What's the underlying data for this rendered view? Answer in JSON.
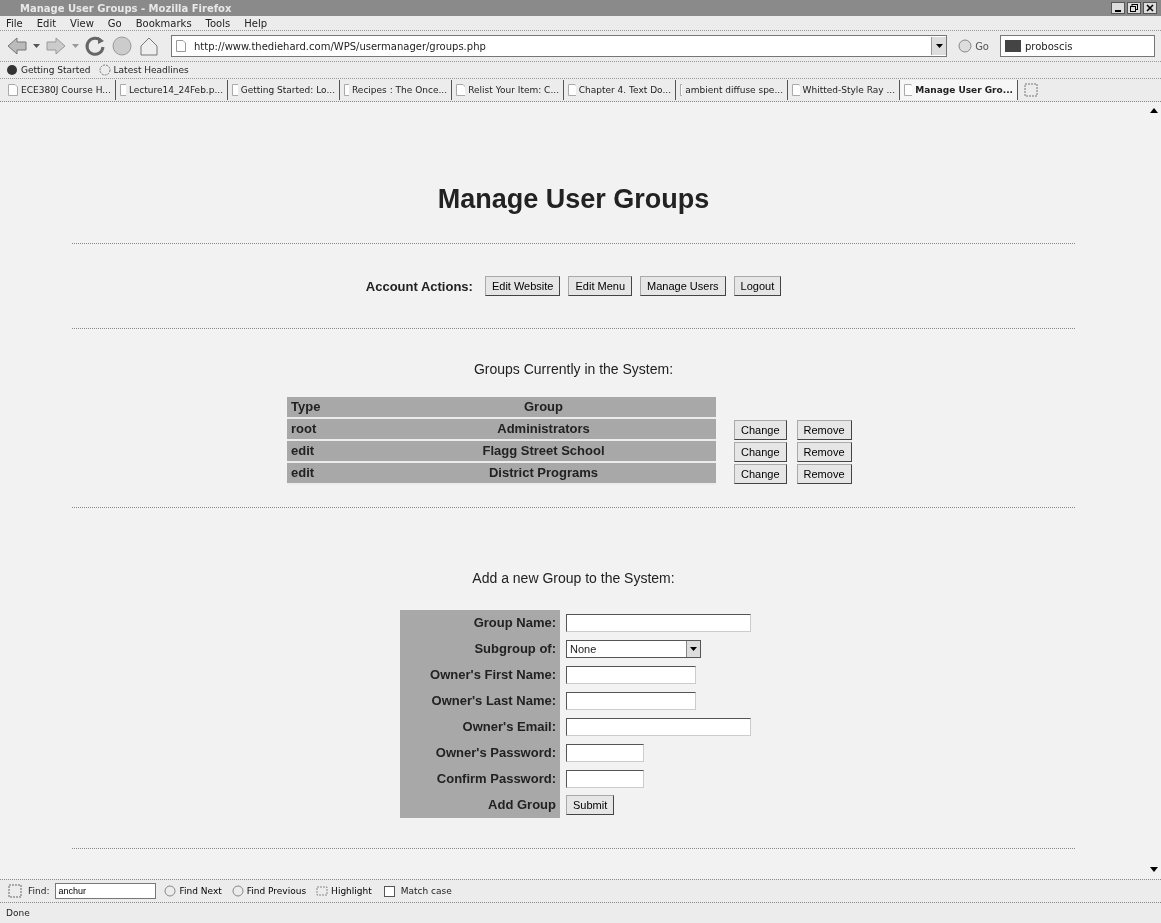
{
  "window": {
    "title": "Manage User Groups - Mozilla Firefox"
  },
  "menu": [
    "File",
    "Edit",
    "View",
    "Go",
    "Bookmarks",
    "Tools",
    "Help"
  ],
  "address": {
    "value": "http://www.thediehard.com/WPS/usermanager/groups.php"
  },
  "go_label": "Go",
  "search": {
    "value": "proboscis"
  },
  "bookmarks": [
    "Getting Started",
    "Latest Headlines"
  ],
  "tabs": [
    {
      "label": "ECE380J Course H...",
      "selected": false
    },
    {
      "label": "Lecture14_24Feb.p...",
      "selected": false
    },
    {
      "label": "Getting Started: Lo...",
      "selected": false
    },
    {
      "label": "Recipes : The Once...",
      "selected": false
    },
    {
      "label": "Relist Your Item: C...",
      "selected": false
    },
    {
      "label": "Chapter 4. Text Do...",
      "selected": false
    },
    {
      "label": "ambient diffuse spe...",
      "selected": false
    },
    {
      "label": "Whitted-Style Ray ...",
      "selected": false
    },
    {
      "label": "Manage User Gro...",
      "selected": true
    }
  ],
  "page": {
    "heading": "Manage User Groups",
    "account_actions": {
      "label": "Account Actions:",
      "buttons": [
        "Edit Website",
        "Edit Menu",
        "Manage Users",
        "Logout"
      ]
    },
    "groups": {
      "title": "Groups Currently in the System:",
      "columns": [
        "Type",
        "Group"
      ],
      "rows": [
        {
          "type": "root",
          "group": "Administrators",
          "actions": [
            "Change",
            "Remove"
          ]
        },
        {
          "type": "edit",
          "group": "Flagg Street School",
          "actions": [
            "Change",
            "Remove"
          ]
        },
        {
          "type": "edit",
          "group": "District Programs",
          "actions": [
            "Change",
            "Remove"
          ]
        }
      ]
    },
    "add_group": {
      "title": "Add a new Group to the System:",
      "fields": [
        {
          "label": "Group Name:",
          "kind": "text"
        },
        {
          "label": "Subgroup of:",
          "kind": "select",
          "value": "None"
        },
        {
          "label": "Owner's First Name:",
          "kind": "text"
        },
        {
          "label": "Owner's Last Name:",
          "kind": "text"
        },
        {
          "label": "Owner's Email:",
          "kind": "text"
        },
        {
          "label": "Owner's Password:",
          "kind": "text"
        },
        {
          "label": "Confirm Password:",
          "kind": "text"
        }
      ],
      "submit_label": "Add Group",
      "submit_button": "Submit"
    }
  },
  "find_bar": {
    "label": "Find:",
    "value": "anchur",
    "find_next": "Find Next",
    "find_previous": "Find Previous",
    "highlight": "Highlight",
    "match_case": {
      "label": "Match case",
      "checked": false
    }
  },
  "status_bar": "Done"
}
